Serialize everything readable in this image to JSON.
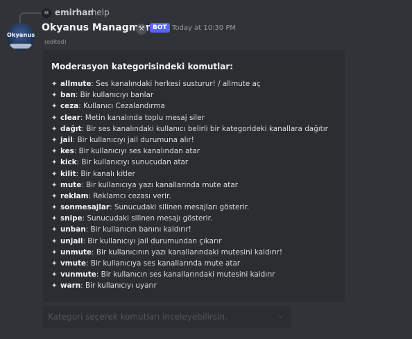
{
  "reply": {
    "avatar_icon": "skull-icon",
    "name": "emirhan",
    "text": ".help"
  },
  "message": {
    "avatar_text": "Okyanus",
    "username": "Okyanus Managment",
    "bot_badge": "BOT",
    "timestamp": "Today at 10:30 PM",
    "edited": "(edited)"
  },
  "embed": {
    "title": "Moderasyon kategorisindeki komutlar:",
    "bullet_icon": "sparkle-icon",
    "commands": [
      {
        "name": "allmute",
        "desc": ": Ses kanalındaki herkesi susturur! / allmute aç"
      },
      {
        "name": "ban",
        "desc": ": Bir kullanıcıyı banlar"
      },
      {
        "name": "ceza",
        "desc": ": Kullanıcı Cezalandırma"
      },
      {
        "name": "clear",
        "desc": ": Metin kanalında toplu mesaj siler"
      },
      {
        "name": "dağıt",
        "desc": ": Bir ses kanalındaki kullanıcı belirli bir kategorideki kanallara dağıtır"
      },
      {
        "name": "jail",
        "desc": ": Bir kullanıcıyı jail durumuna alır!"
      },
      {
        "name": "kes",
        "desc": ": Bir kullanıcıyı ses kanalından atar"
      },
      {
        "name": "kick",
        "desc": ": Bir kullanıcıyı sunucudan atar"
      },
      {
        "name": "kilit",
        "desc": ": Bir kanalı kitler"
      },
      {
        "name": "mute",
        "desc": ": Bir kullanıcıya yazı kanallarında mute atar"
      },
      {
        "name": "reklam",
        "desc": ": Reklamcı cezası verir."
      },
      {
        "name": "sonmesajlar",
        "desc": ": Sunucudaki silinen mesajları gösterir."
      },
      {
        "name": "snipe",
        "desc": ": Sunucudaki silinen mesajı gösterir."
      },
      {
        "name": "unban",
        "desc": ": Bir kullanıcın banını kaldırır!"
      },
      {
        "name": "unjail",
        "desc": ": Bir kullanıcıyı jail durumundan çıkarır"
      },
      {
        "name": "unmute",
        "desc": ": Bir kullanıcının yazı kanallarındaki mutesini kaldırır!"
      },
      {
        "name": "vmute",
        "desc": ": Bir kullanıcıya ses kanallarında mute atar"
      },
      {
        "name": "vunmute",
        "desc": ": Bir kullanıcın ses kanallarındaki mutesini kaldırır"
      },
      {
        "name": "warn",
        "desc": ": Bir kullanıcıyı uyarır"
      }
    ]
  },
  "select_menu": {
    "placeholder": "Kategori seçerek komutları inceleyebilirsin.",
    "icon": "chevron-down-icon"
  },
  "colors": {
    "background": "#313338",
    "embed_background": "#2b2d31",
    "bot_badge": "#5865f2"
  }
}
